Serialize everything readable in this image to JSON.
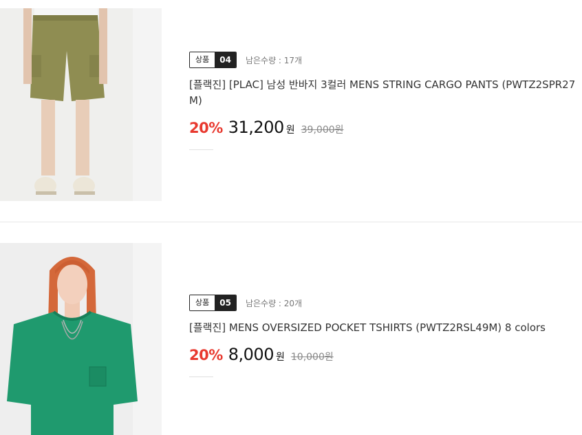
{
  "products": [
    {
      "badge_label": "상품",
      "badge_number": "04",
      "stock": "남은수량 : 17개",
      "name": "[플랙진] [PLAC] 남성 반바지 3컬러 MENS STRING CARGO PANTS (PWTZ2SPR27M)",
      "discount": "20%",
      "sale_price": "31,200",
      "sale_unit": "원",
      "original_price": "39,000원"
    },
    {
      "badge_label": "상품",
      "badge_number": "05",
      "stock": "남은수량 : 20개",
      "name": "[플랙진] MENS OVERSIZED POCKET TSHIRTS (PWTZ2RSL49M) 8 colors",
      "discount": "20%",
      "sale_price": "8,000",
      "sale_unit": "원",
      "original_price": "10,000원"
    }
  ],
  "colors": {
    "discount": "#e8392f",
    "badge_dark": "#222222",
    "shorts_khaki": "#8f8d52",
    "tshirt_green": "#1f9a6e"
  }
}
